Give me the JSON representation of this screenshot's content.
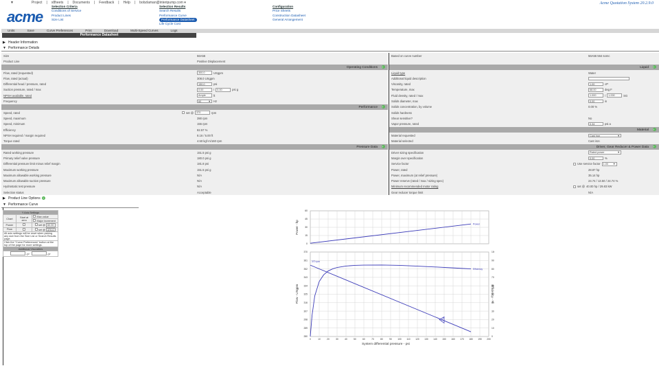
{
  "header": {
    "user_menu": [
      "Project",
      "x8heets",
      "Documents",
      "Feedback",
      "Help",
      "bobzlaman@interipump.com ▾"
    ],
    "logo": "acme",
    "app_name": "Acme Quotation System 20.2.9.0",
    "menus": [
      {
        "title": "Selection Criteria",
        "items": [
          "Conditions of Service",
          "Product Lines",
          "Size List"
        ]
      },
      {
        "title": "Selection Results",
        "items": [
          "Search Results",
          "Performance Curve",
          "Performance Datasheet",
          "Life Cycle Cost"
        ],
        "selected": 2
      },
      {
        "title": "Configuration",
        "items": [
          "Price Sheets",
          "Construction Datasheet",
          "General Arrangement"
        ]
      }
    ]
  },
  "toolbar": [
    "Units",
    "Save",
    "Curve Preferences",
    "Print",
    "Download",
    "Multi-Speed Curves",
    "Logs"
  ],
  "page_title": "Performance Datasheet",
  "sections": {
    "header_info": "Header Information",
    "perf_details": "Performance Details",
    "product_options": "Product Line Options",
    "perf_curve": "Performance Curve"
  },
  "left": {
    "size": {
      "label": "Size",
      "value": "56A56"
    },
    "product_line": {
      "label": "Product Line",
      "value": "Positive Displacement"
    },
    "operating": {
      "title": "Operating Conditions",
      "rows": [
        {
          "label": "Flow, rated (requested)",
          "input": "300.0",
          "unit": "USgpm"
        },
        {
          "label": "Flow, rated (actual)",
          "value": "308.0 USgpm"
        },
        {
          "label": "Differential head / pressure, rated",
          "input": "150.0",
          "unit": "psi"
        },
        {
          "label": "Suction pressure, rated / max",
          "input": "0.00",
          "input2": "0.00",
          "unit": "psi g"
        },
        {
          "label": "NPSH available, rated",
          "input": "Ample",
          "unit": "ft",
          "link": true
        },
        {
          "label": "Frequency",
          "select": "60",
          "unit": "Hz"
        }
      ]
    },
    "performance": {
      "title": "Performance",
      "rows": [
        {
          "label": "Speed, rated",
          "check": "set @",
          "input": "370",
          "unit": "rpm"
        },
        {
          "label": "Speed, maximum",
          "value": "390 rpm"
        },
        {
          "label": "Speed, minimum",
          "value": "155 rpm"
        },
        {
          "label": "Efficiency",
          "value": "82.57 %"
        },
        {
          "label": "NPSH required / margin required",
          "value": "8.16 / 5.00 ft"
        },
        {
          "label": "Torque rated",
          "value": "4.50 kgf·m/160 rpm"
        }
      ]
    },
    "pressure": {
      "title": "Pressure Data",
      "rows": [
        {
          "label": "Rated working pressure",
          "value": "151.5 psi g"
        },
        {
          "label": "Primary relief valve pressure",
          "value": "180.0 psi g"
        },
        {
          "label": "Differential pressure limit minus relief margin",
          "value": "181.8 psi"
        },
        {
          "label": "Maximum working pressure",
          "value": "151.5 psi g"
        },
        {
          "label": "Maximum allowable working pressure",
          "value": "N/A"
        },
        {
          "label": "Maximum allowable suction pressure",
          "value": "N/A"
        },
        {
          "label": "Hydrostatic test pressure",
          "value": "N/A"
        },
        {
          "label": "Selection status",
          "value": "Acceptable"
        }
      ]
    }
  },
  "right": {
    "curve_number": {
      "label": "Based on curve number",
      "value": "56A56 564 somc"
    },
    "liquid": {
      "title": "Liquid",
      "rows": [
        {
          "label": "Liquid type",
          "value": "Water",
          "link": true
        },
        {
          "label": "Additional liquid description",
          "input": " "
        },
        {
          "label": "Viscosity, rated",
          "input": "1.00",
          "unit": "cP"
        },
        {
          "label": "Temperature, max",
          "input": "68.00",
          "unit": "deg F"
        },
        {
          "label": "Fluid density, rated / max",
          "input": "1.000",
          "input2": "1.000",
          "unit": "SG"
        },
        {
          "label": "Solids diameter, max",
          "input": "0.00",
          "unit": "in"
        },
        {
          "label": "Solids concentration, by volume",
          "value": "0.00 %"
        },
        {
          "label": "Solids hardness",
          "value": ""
        },
        {
          "label": "Shear sensitive?",
          "value": "No"
        },
        {
          "label": "Vapor pressure, rated",
          "input": "0.34",
          "unit": "psi a"
        }
      ]
    },
    "material": {
      "title": "Material",
      "rows": [
        {
          "label": "Material requested",
          "select": "Cast iron"
        },
        {
          "label": "Material selected",
          "value": "Cast iron"
        }
      ]
    },
    "driver": {
      "title": "Driver, Gear Reducer & Power Data",
      "rows": [
        {
          "label": "Driver sizing specification",
          "select": "Rated power"
        },
        {
          "label": "Margin over specification",
          "input": "0.00",
          "unit": "%"
        },
        {
          "label": "Service factor",
          "check": "Use service factor",
          "select": "1.00"
        },
        {
          "label": "Power, rated",
          "value": "28.87 hp"
        },
        {
          "label": "Power, maximum (at relief pressure)",
          "value": "35.14 hp"
        },
        {
          "label": "Power reserve (rated / max / sizing spec)",
          "value": "24.74 / 13.50 / 24.74 %"
        },
        {
          "label": "Minimum recommended motor rating",
          "check": "set @",
          "value": "40.00 hp / 29.83 kW",
          "link": true
        },
        {
          "label": "Gear reducer torque limit",
          "value": "N/A"
        }
      ]
    }
  },
  "yaxis": {
    "title": "Y Axis Settings",
    "chart": "Chart",
    "start_zero": "Start at zero",
    "max_value": "Max value",
    "major_inc": "Major increment",
    "rows": [
      {
        "name": "Power",
        "set": "set @",
        "value": "60.00"
      },
      {
        "name": "Flow",
        "set": "set @",
        "value": "370.0"
      }
    ],
    "note1": "All axis settings will be reset when picking any size from the Size List or Search Results page.",
    "note2": "Click the \"Curve Preferences\" button at the top of the page for more settings.",
    "additional": "Additional Viscosities",
    "unit1": "cP",
    "unit2": "cP"
  },
  "chart_data": [
    {
      "type": "line",
      "ylabel": "Power - hp",
      "ylim": [
        0,
        60
      ],
      "yticks": [
        "0",
        "15",
        "30",
        "45",
        "60"
      ],
      "xlim": [
        0,
        200
      ],
      "series": [
        {
          "name": "Power",
          "x": [
            0,
            180
          ],
          "y": [
            1,
            36
          ]
        }
      ]
    },
    {
      "type": "line",
      "xlabel": "System differential pressure - psi",
      "ylabel": "Flow - USgpm",
      "y2label": "Efficiency - %",
      "xlim": [
        0,
        200
      ],
      "ylim": [
        280,
        370
      ],
      "y2lim": [
        0,
        100
      ],
      "xticks": [
        "0",
        "10",
        "20",
        "30",
        "40",
        "50",
        "60",
        "70",
        "80",
        "90",
        "100",
        "110",
        "120",
        "130",
        "140",
        "150",
        "160",
        "170",
        "180",
        "190",
        "200"
      ],
      "yticks": [
        "280",
        "289",
        "298",
        "307",
        "316",
        "325",
        "334",
        "343",
        "352",
        "361",
        "370"
      ],
      "y2ticks": [
        "0",
        "10",
        "20",
        "30",
        "40",
        "50",
        "60",
        "70",
        "80",
        "90",
        "100"
      ],
      "series": [
        {
          "name": "370 rpm",
          "axis": "y",
          "x": [
            0,
            180
          ],
          "y": [
            356,
            285
          ]
        },
        {
          "name": "Efficiency",
          "axis": "y2",
          "x": [
            0,
            2,
            5,
            10,
            15,
            20,
            25,
            30,
            40,
            50,
            60,
            80,
            100,
            120,
            140,
            160,
            180
          ],
          "y": [
            0,
            25,
            48,
            65,
            73,
            77.5,
            80,
            81.7,
            83.4,
            84.2,
            84.5,
            84.6,
            84.2,
            83.3,
            82.3,
            81.2,
            80
          ]
        }
      ],
      "operating_point": {
        "x": 150,
        "y": 298
      }
    }
  ]
}
